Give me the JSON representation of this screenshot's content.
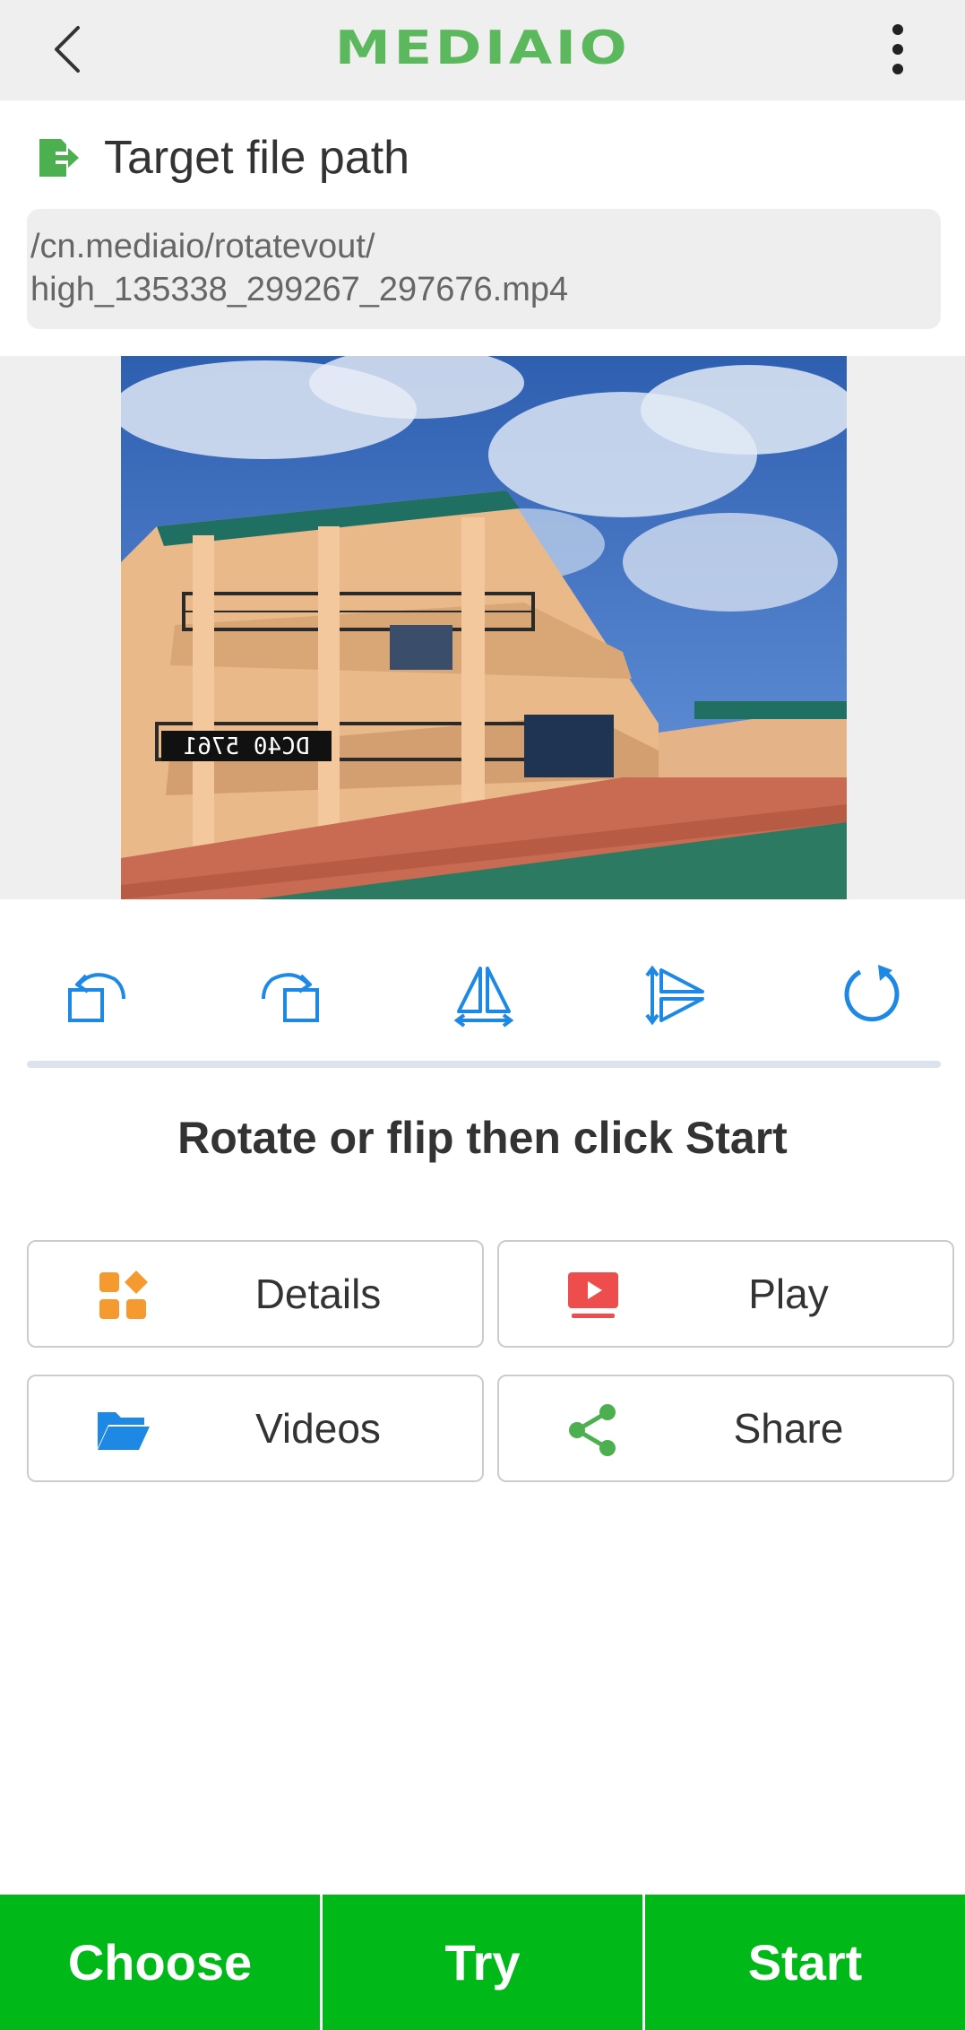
{
  "topbar": {
    "logo": "MEDIAIO",
    "back_icon": "chevron-left-icon",
    "menu_icon": "more-vertical-icon"
  },
  "target": {
    "title": "Target file path",
    "icon": "export-file-icon",
    "path": "/cn.mediaio/rotatevout/\nhigh_135338_299267_297676.mp4"
  },
  "preview": {
    "overlay_text": "DC40 5761"
  },
  "tools": [
    {
      "name": "rotate-left",
      "icon": "rotate-left-icon"
    },
    {
      "name": "rotate-right",
      "icon": "rotate-right-icon"
    },
    {
      "name": "flip-horizontal",
      "icon": "flip-horizontal-icon"
    },
    {
      "name": "flip-vertical",
      "icon": "flip-vertical-icon"
    },
    {
      "name": "reset",
      "icon": "reset-icon"
    }
  ],
  "instruction": "Rotate or flip then click Start",
  "actions": {
    "details": "Details",
    "play": "Play",
    "videos": "Videos",
    "share": "Share"
  },
  "bottom": {
    "choose": "Choose",
    "try": "Try",
    "start": "Start"
  },
  "colors": {
    "accent_green": "#00b818",
    "logo_green": "#5cb85c",
    "tool_blue": "#1e88e5",
    "details_orange": "#f59a2f",
    "play_red": "#ee4d4d",
    "share_green": "#4caf50"
  }
}
